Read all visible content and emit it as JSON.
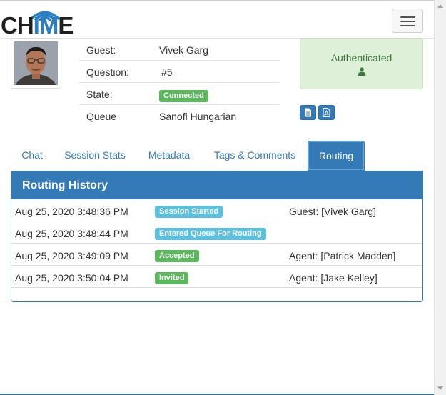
{
  "brand": {
    "logo_text_dark": "CH",
    "logo_text_accent": "IM",
    "logo_text_end": "E",
    "icon": "wifi-arcs-icon"
  },
  "navbar": {
    "menu_icon": "hamburger-menu-icon"
  },
  "session": {
    "guest_label": "Guest:",
    "guest_value": "Vivek Garg",
    "question_label": "Question:",
    "question_value": "#5",
    "state_label": "State:",
    "state_value": "Connected",
    "queue_label": "Queue",
    "queue_value": "Sanofi Hungarian"
  },
  "auth": {
    "text": "Authenticated",
    "icon": "user-icon"
  },
  "export_buttons": {
    "doc_icon": "file-text-icon",
    "pdf_icon": "file-pdf-icon"
  },
  "tabs": [
    {
      "label": "Chat",
      "active": false
    },
    {
      "label": "Session Stats",
      "active": false
    },
    {
      "label": "Metadata",
      "active": false
    },
    {
      "label": "Tags & Comments",
      "active": false
    },
    {
      "label": "Routing",
      "active": true
    }
  ],
  "routing": {
    "title": "Routing History",
    "rows": [
      {
        "time": "Aug 25, 2020 3:48:36 PM",
        "event": "Session Started",
        "event_color": "#5bc0de",
        "detail": "Guest: [Vivek Garg]"
      },
      {
        "time": "Aug 25, 2020 3:48:44 PM",
        "event": "Entered Queue For Routing",
        "event_color": "#5bc0de",
        "detail": ""
      },
      {
        "time": "Aug 25, 2020 3:49:09 PM",
        "event": "Accepted",
        "event_color": "#5cb85c",
        "detail": "Agent: [Patrick Madden]"
      },
      {
        "time": "Aug 25, 2020 3:50:04 PM",
        "event": "Invited",
        "event_color": "#5cb85c",
        "detail": "Agent: [Jake Kelley]"
      }
    ]
  },
  "colors": {
    "primary": "#337ab7",
    "success": "#5cb85c",
    "info": "#5bc0de",
    "auth_bg": "#dff0d8"
  }
}
